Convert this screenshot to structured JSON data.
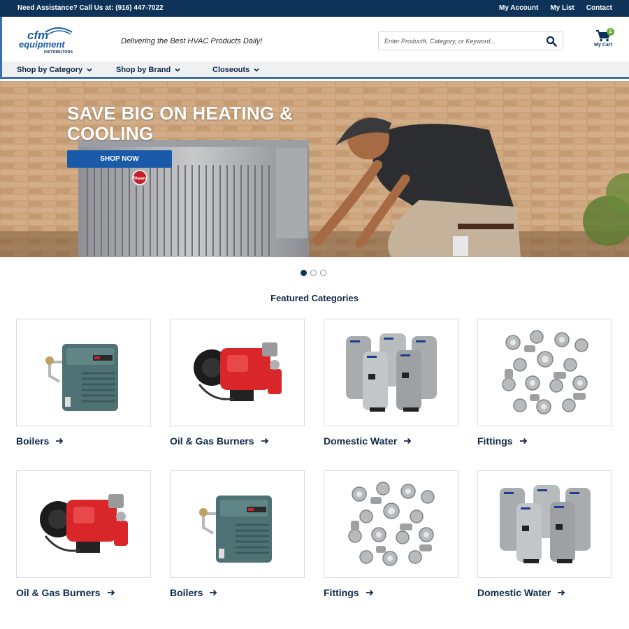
{
  "topbar": {
    "assist": "Need Assistance? Call Us at:  (916) 447-7022",
    "links": [
      "My Account",
      "My List",
      "Contact"
    ]
  },
  "header": {
    "logo_main": "cfm",
    "logo_sub": "equipment",
    "logo_tag": "DISTRIBUTORS",
    "tagline": "Delivering the Best HVAC Products Daily!",
    "search_placeholder": "Enter Product#, Category, or Keyword...",
    "cart_label": "My Cart",
    "cart_count": "2"
  },
  "nav": {
    "items": [
      "Shop by Category",
      "Shop by Brand",
      "Closeouts"
    ]
  },
  "hero": {
    "title": "SAVE BIG ON HEATING & COOLING",
    "button": "SHOP NOW",
    "unit_brand": "Rheem",
    "slides_total": 3,
    "active_slide": 1
  },
  "featured": {
    "heading": "Featured Categories",
    "cards": [
      {
        "label": "Boilers",
        "kind": "boiler"
      },
      {
        "label": "Oil & Gas Burners",
        "kind": "burner"
      },
      {
        "label": "Domestic Water",
        "kind": "water"
      },
      {
        "label": "Fittings",
        "kind": "fittings"
      },
      {
        "label": "Oil & Gas Burners",
        "kind": "burner"
      },
      {
        "label": "Boilers",
        "kind": "boiler"
      },
      {
        "label": "Fittings",
        "kind": "fittings"
      },
      {
        "label": "Domestic Water",
        "kind": "water"
      }
    ]
  },
  "colors": {
    "brand_navy": "#0e3358",
    "accent_blue": "#1a5aa8",
    "cart_badge": "#6aaa30"
  }
}
